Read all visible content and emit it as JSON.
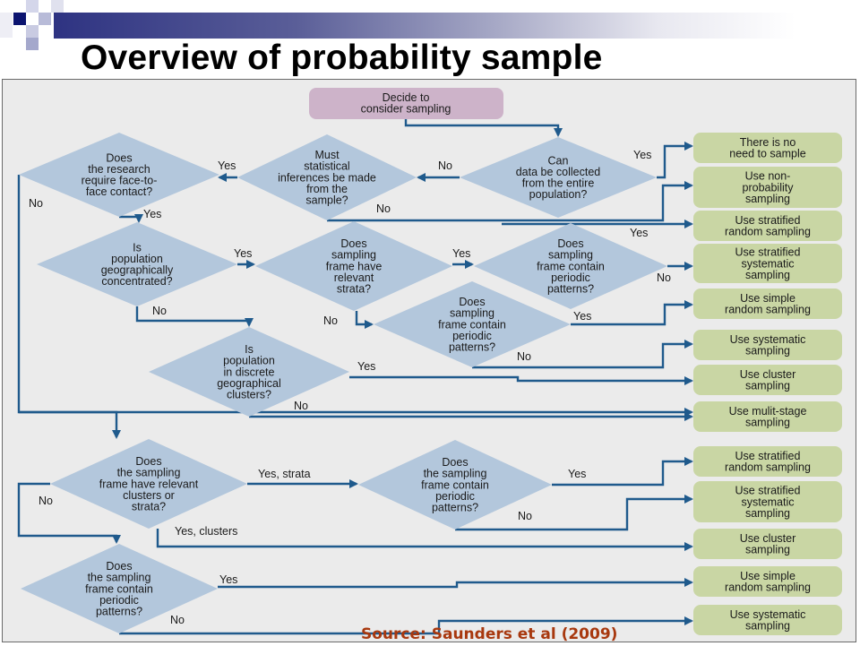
{
  "slide": {
    "title": "Overview of probability sample",
    "source": "Source: Saunders et al (2009)",
    "colors": {
      "title_bar_dark": "#2e3382",
      "decision_fill": "#b3c7dc",
      "outcome_fill": "#c9d6a4",
      "start_fill": "#cdb3c9",
      "connector": "#1f5a8c",
      "source_text": "#a8380e",
      "panel_bg": "#ebebeb"
    }
  },
  "flowchart": {
    "start": {
      "id": "start",
      "lines": [
        "Decide to",
        "consider sampling"
      ]
    },
    "decisions": [
      {
        "id": "d-entire-population",
        "lines": [
          "Can",
          "data be collected",
          "from the entire",
          "population?"
        ]
      },
      {
        "id": "d-statistical-inferences",
        "lines": [
          "Must",
          "statistical",
          "inferences be made",
          "from the",
          "sample?"
        ]
      },
      {
        "id": "d-face-to-face",
        "lines": [
          "Does",
          "the research",
          "require face-to-",
          "face contact?"
        ]
      },
      {
        "id": "d-geo-concentrated",
        "lines": [
          "Is",
          "population",
          "geographically",
          "concentrated?"
        ]
      },
      {
        "id": "d-relevant-strata",
        "lines": [
          "Does",
          "sampling",
          "frame have",
          "relevant",
          "strata?"
        ]
      },
      {
        "id": "d-periodic-1",
        "lines": [
          "Does",
          "sampling",
          "frame contain",
          "periodic",
          "patterns?"
        ]
      },
      {
        "id": "d-periodic-2",
        "lines": [
          "Does",
          "sampling",
          "frame contain",
          "periodic",
          "patterns?"
        ]
      },
      {
        "id": "d-discrete-clusters",
        "lines": [
          "Is",
          "population",
          "in discrete",
          "geographical",
          "clusters?"
        ]
      },
      {
        "id": "d-clusters-or-strata",
        "lines": [
          "Does",
          "the sampling",
          "frame have relevant",
          "clusters or",
          "strata?"
        ]
      },
      {
        "id": "d-periodic-3",
        "lines": [
          "Does",
          "the sampling",
          "frame contain",
          "periodic",
          "patterns?"
        ]
      },
      {
        "id": "d-periodic-4",
        "lines": [
          "Does",
          "the sampling",
          "frame contain",
          "periodic",
          "patterns?"
        ]
      }
    ],
    "outcomes": [
      {
        "id": "o-no-need",
        "lines": [
          "There is no",
          "need to sample"
        ]
      },
      {
        "id": "o-non-probability",
        "lines": [
          "Use non-",
          "probability",
          "sampling"
        ]
      },
      {
        "id": "o-stratified-random-1",
        "lines": [
          "Use stratified",
          "random sampling"
        ]
      },
      {
        "id": "o-stratified-systematic-1",
        "lines": [
          "Use stratified",
          "systematic",
          "sampling"
        ]
      },
      {
        "id": "o-simple-random-1",
        "lines": [
          "Use simple",
          "random sampling"
        ]
      },
      {
        "id": "o-systematic-1",
        "lines": [
          "Use systematic",
          "sampling"
        ]
      },
      {
        "id": "o-cluster-1",
        "lines": [
          "Use cluster",
          "sampling"
        ]
      },
      {
        "id": "o-multi-stage",
        "lines": [
          "Use mulit-stage",
          "sampling"
        ]
      },
      {
        "id": "o-stratified-random-2",
        "lines": [
          "Use stratified",
          "random sampling"
        ]
      },
      {
        "id": "o-stratified-systematic-2",
        "lines": [
          "Use stratified",
          "systematic",
          "sampling"
        ]
      },
      {
        "id": "o-cluster-2",
        "lines": [
          "Use cluster",
          "sampling"
        ]
      },
      {
        "id": "o-simple-random-2",
        "lines": [
          "Use simple",
          "random sampling"
        ]
      },
      {
        "id": "o-systematic-2",
        "lines": [
          "Use systematic",
          "sampling"
        ]
      }
    ],
    "edge_labels": [
      {
        "id": "l-entire-yes",
        "text": "Yes"
      },
      {
        "id": "l-entire-no",
        "text": "No"
      },
      {
        "id": "l-inference-yes",
        "text": "Yes"
      },
      {
        "id": "l-inference-no",
        "text": "No"
      },
      {
        "id": "l-face-no",
        "text": "No"
      },
      {
        "id": "l-face-yes",
        "text": "Yes"
      },
      {
        "id": "l-geo-yes",
        "text": "Yes"
      },
      {
        "id": "l-geo-no",
        "text": "No"
      },
      {
        "id": "l-strata-yes",
        "text": "Yes"
      },
      {
        "id": "l-strata-no",
        "text": "No"
      },
      {
        "id": "l-periodic1-yes",
        "text": "Yes"
      },
      {
        "id": "l-periodic1-no",
        "text": "No"
      },
      {
        "id": "l-periodic2-yes",
        "text": "Yes"
      },
      {
        "id": "l-periodic2-no",
        "text": "No"
      },
      {
        "id": "l-clusters-yes",
        "text": "Yes"
      },
      {
        "id": "l-clusters-no",
        "text": "No"
      },
      {
        "id": "l-cs-yes-strata",
        "text": "Yes, strata"
      },
      {
        "id": "l-cs-no",
        "text": "No"
      },
      {
        "id": "l-cs-yes-clusters",
        "text": "Yes, clusters"
      },
      {
        "id": "l-periodic3-yes",
        "text": "Yes"
      },
      {
        "id": "l-periodic3-no",
        "text": "No"
      },
      {
        "id": "l-periodic4-yes",
        "text": "Yes"
      },
      {
        "id": "l-periodic4-no",
        "text": "No"
      }
    ]
  }
}
